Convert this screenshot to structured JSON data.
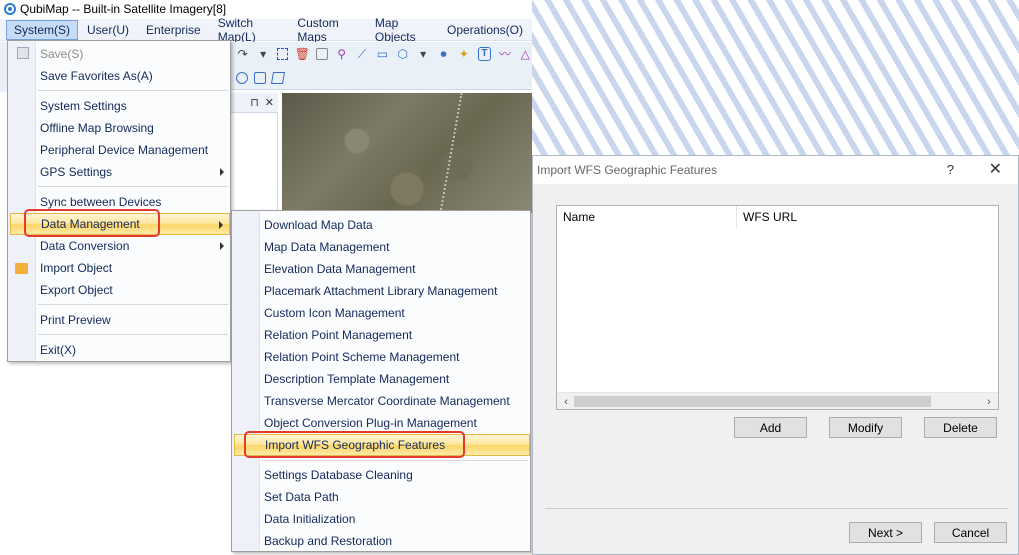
{
  "app": {
    "title": "QubiMap -- Built-in Satellite Imagery[8]"
  },
  "menubar": {
    "items": [
      "System(S)",
      "User(U)",
      "Enterprise",
      "Switch Map(L)",
      "Custom Maps",
      "Map Objects",
      "Operations(O)"
    ]
  },
  "system_menu": {
    "items": [
      {
        "label": "Save(S)",
        "disabled": true
      },
      {
        "label": "Save Favorites As(A)"
      },
      {
        "label": "System Settings"
      },
      {
        "label": "Offline Map Browsing"
      },
      {
        "label": "Peripheral Device Management"
      },
      {
        "label": "GPS Settings"
      },
      {
        "label": "Sync between Devices"
      },
      {
        "label": "Data Management"
      },
      {
        "label": "Data Conversion"
      },
      {
        "label": "Import Object"
      },
      {
        "label": "Export Object"
      },
      {
        "label": "Print Preview"
      },
      {
        "label": "Exit(X)"
      }
    ]
  },
  "data_menu": {
    "items": [
      {
        "label": "Download Map Data"
      },
      {
        "label": "Map Data Management"
      },
      {
        "label": "Elevation Data Management"
      },
      {
        "label": "Placemark Attachment Library Management"
      },
      {
        "label": "Custom Icon Management"
      },
      {
        "label": "Relation Point Management"
      },
      {
        "label": "Relation Point Scheme Management"
      },
      {
        "label": "Description Template Management"
      },
      {
        "label": "Transverse Mercator Coordinate Management"
      },
      {
        "label": "Object Conversion Plug-in Management"
      },
      {
        "label": "Import WFS Geographic Features"
      },
      {
        "label": "Settings Database Cleaning"
      },
      {
        "label": "Set Data Path"
      },
      {
        "label": "Data Initialization"
      },
      {
        "label": "Backup and Restoration"
      }
    ]
  },
  "dialog": {
    "title": "Import WFS Geographic Features",
    "help": "?",
    "close": "✕",
    "columns": [
      "Name",
      "WFS URL"
    ],
    "buttons": {
      "add": "Add",
      "modify": "Modify",
      "delete": "Delete",
      "next": "Next >",
      "cancel": "Cancel"
    }
  },
  "panel": {
    "pin": "⊓",
    "close": "✕"
  },
  "colors": {
    "highlight_border": "#e23b2e",
    "menu_text": "#14285a"
  }
}
